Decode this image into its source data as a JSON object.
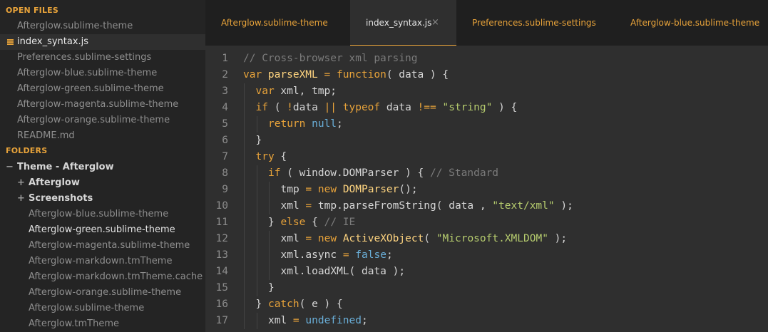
{
  "sidebar": {
    "open_files_heading": "OPEN FILES",
    "open_files": [
      "Afterglow.sublime-theme",
      "index_syntax.js",
      "Preferences.sublime-settings",
      "Afterglow-blue.sublime-theme",
      "Afterglow-green.sublime-theme",
      "Afterglow-magenta.sublime-theme",
      "Afterglow-orange.sublime-theme",
      "README.md"
    ],
    "folders_heading": "FOLDERS",
    "root_folder": "Theme - Afterglow",
    "root_folder_icon": "−",
    "subfolders": [
      "Afterglow",
      "Screenshots"
    ],
    "subfolder_icon": "+",
    "folder_files": [
      "Afterglow-blue.sublime-theme",
      "Afterglow-green.sublime-theme",
      "Afterglow-magenta.sublime-theme",
      "Afterglow-markdown.tmTheme",
      "Afterglow-markdown.tmTheme.cache",
      "Afterglow-orange.sublime-theme",
      "Afterglow.sublime-theme",
      "Afterglow.tmTheme"
    ]
  },
  "tabs": [
    {
      "label": "Afterglow.sublime-theme",
      "active": false
    },
    {
      "label": "index_syntax.js",
      "active": true,
      "close": "×"
    },
    {
      "label": "Preferences.sublime-settings",
      "active": false
    },
    {
      "label": "Afterglow-blue.sublime-theme",
      "active": false
    }
  ],
  "colors": {
    "accent": "#e8a33a",
    "sidebar_bg": "#242424",
    "editor_bg": "#2f2f2f",
    "comment": "#7b7b7b",
    "keyword": "#e8a33a",
    "function": "#ffd580",
    "string": "#b6cc6e",
    "constant": "#6aafd9"
  },
  "editor": {
    "file": "index_syntax.js",
    "lines": [
      {
        "n": "1",
        "indent": 0,
        "tokens": [
          [
            "// Cross-browser xml parsing",
            "comment"
          ]
        ]
      },
      {
        "n": "2",
        "indent": 0,
        "tokens": [
          [
            "var ",
            "kw"
          ],
          [
            "parseXML",
            "fn"
          ],
          [
            " = ",
            "kw"
          ],
          [
            "function",
            "kw"
          ],
          [
            "( data ) {",
            "plain"
          ]
        ]
      },
      {
        "n": "3",
        "indent": 1,
        "tokens": [
          [
            "var ",
            "kw"
          ],
          [
            "xml, tmp;",
            "plain"
          ]
        ]
      },
      {
        "n": "4",
        "indent": 1,
        "tokens": [
          [
            "if",
            "kw"
          ],
          [
            " ( ",
            "plain"
          ],
          [
            "!",
            "kw"
          ],
          [
            "data ",
            "plain"
          ],
          [
            "||",
            "kw"
          ],
          [
            " ",
            "plain"
          ],
          [
            "typeof",
            "kw"
          ],
          [
            " data ",
            "plain"
          ],
          [
            "!==",
            "kw"
          ],
          [
            " ",
            "plain"
          ],
          [
            "\"string\"",
            "str"
          ],
          [
            " ) {",
            "plain"
          ]
        ]
      },
      {
        "n": "5",
        "indent": 2,
        "tokens": [
          [
            "return ",
            "kw"
          ],
          [
            "null",
            "const"
          ],
          [
            ";",
            "plain"
          ]
        ]
      },
      {
        "n": "6",
        "indent": 1,
        "tokens": [
          [
            "}",
            "plain"
          ]
        ]
      },
      {
        "n": "7",
        "indent": 1,
        "tokens": [
          [
            "try",
            "kw"
          ],
          [
            " {",
            "plain"
          ]
        ]
      },
      {
        "n": "8",
        "indent": 2,
        "tokens": [
          [
            "if",
            "kw"
          ],
          [
            " ( window.DOMParser ) { ",
            "plain"
          ],
          [
            "// Standard",
            "comment"
          ]
        ]
      },
      {
        "n": "9",
        "indent": 3,
        "tokens": [
          [
            "tmp ",
            "plain"
          ],
          [
            "=",
            "kw"
          ],
          [
            " ",
            "plain"
          ],
          [
            "new",
            "kw"
          ],
          [
            " ",
            "plain"
          ],
          [
            "DOMParser",
            "fn"
          ],
          [
            "();",
            "plain"
          ]
        ]
      },
      {
        "n": "10",
        "indent": 3,
        "tokens": [
          [
            "xml ",
            "plain"
          ],
          [
            "=",
            "kw"
          ],
          [
            " tmp.parseFromString( data , ",
            "plain"
          ],
          [
            "\"text/xml\"",
            "str"
          ],
          [
            " );",
            "plain"
          ]
        ]
      },
      {
        "n": "11",
        "indent": 2,
        "tokens": [
          [
            "} ",
            "plain"
          ],
          [
            "else",
            "kw"
          ],
          [
            " { ",
            "plain"
          ],
          [
            "// IE",
            "comment"
          ]
        ]
      },
      {
        "n": "12",
        "indent": 3,
        "tokens": [
          [
            "xml ",
            "plain"
          ],
          [
            "=",
            "kw"
          ],
          [
            " ",
            "plain"
          ],
          [
            "new",
            "kw"
          ],
          [
            " ",
            "plain"
          ],
          [
            "ActiveXObject",
            "fn"
          ],
          [
            "( ",
            "plain"
          ],
          [
            "\"Microsoft.XMLDOM\"",
            "str"
          ],
          [
            " );",
            "plain"
          ]
        ]
      },
      {
        "n": "13",
        "indent": 3,
        "tokens": [
          [
            "xml.async ",
            "plain"
          ],
          [
            "=",
            "kw"
          ],
          [
            " ",
            "plain"
          ],
          [
            "false",
            "const"
          ],
          [
            ";",
            "plain"
          ]
        ]
      },
      {
        "n": "14",
        "indent": 3,
        "tokens": [
          [
            "xml.loadXML( data );",
            "plain"
          ]
        ]
      },
      {
        "n": "15",
        "indent": 2,
        "tokens": [
          [
            "}",
            "plain"
          ]
        ]
      },
      {
        "n": "16",
        "indent": 1,
        "tokens": [
          [
            "} ",
            "plain"
          ],
          [
            "catch",
            "kw"
          ],
          [
            "( e ) {",
            "plain"
          ]
        ]
      },
      {
        "n": "17",
        "indent": 2,
        "tokens": [
          [
            "xml ",
            "plain"
          ],
          [
            "=",
            "kw"
          ],
          [
            " ",
            "plain"
          ],
          [
            "undefined",
            "const"
          ],
          [
            ";",
            "plain"
          ]
        ]
      }
    ]
  }
}
